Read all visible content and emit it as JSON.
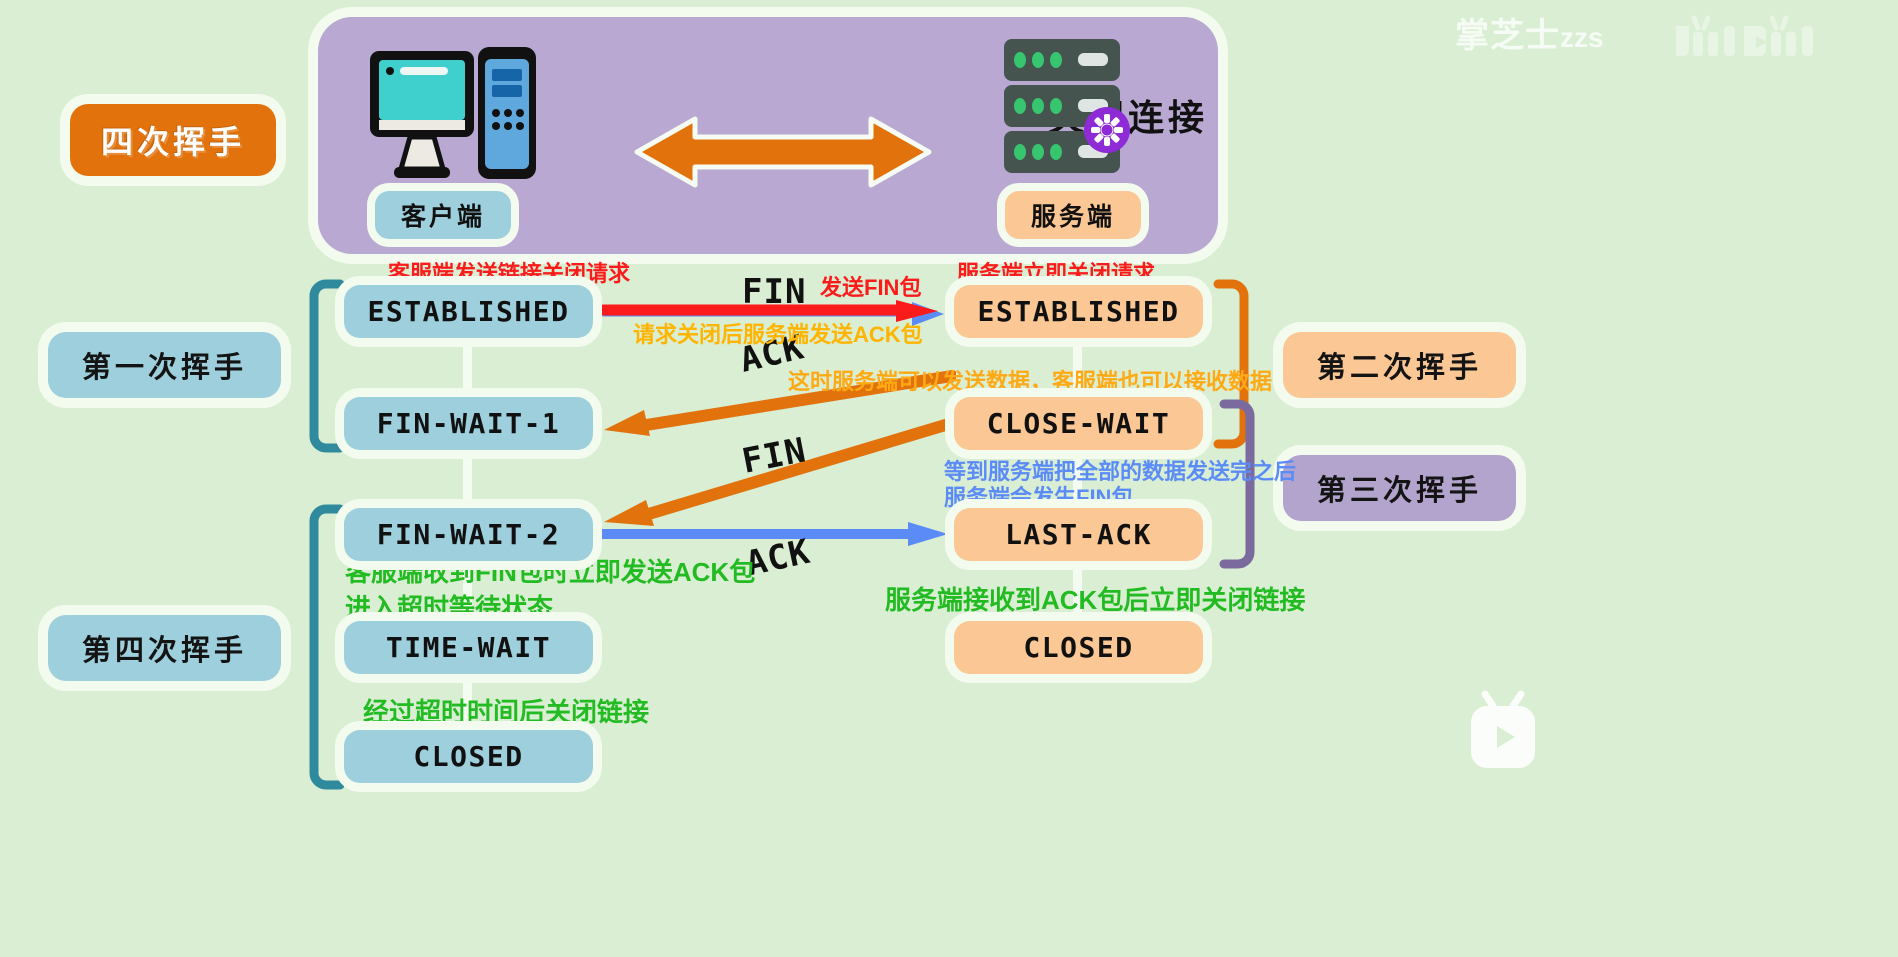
{
  "watermark": {
    "name": "掌芝士",
    "suffix": "zzs",
    "platform": "bilibili"
  },
  "top_panel": {
    "title": "关闭连接",
    "client_label": "客户端",
    "server_label": "服务端",
    "client_icon": "desktop-computer-icon",
    "server_icon": "server-rack-icon",
    "gear_icon": "gear-icon",
    "arrow_icon": "double-headed-arrow-icon"
  },
  "stage_labels": {
    "main": "四次挥手",
    "first": "第一次挥手",
    "second": "第二次挥手",
    "third": "第三次挥手",
    "fourth": "第四次挥手"
  },
  "client_states": [
    {
      "name": "ESTABLISHED"
    },
    {
      "name": "FIN-WAIT-1"
    },
    {
      "name": "FIN-WAIT-2"
    },
    {
      "name": "TIME-WAIT"
    },
    {
      "name": "CLOSED"
    }
  ],
  "server_states": [
    {
      "name": "ESTABLISHED"
    },
    {
      "name": "CLOSE-WAIT"
    },
    {
      "name": "LAST-ACK"
    },
    {
      "name": "CLOSED"
    }
  ],
  "packets": {
    "fin1": "FIN",
    "ack1": "ACK",
    "fin2": "FIN",
    "ack2": "ACK"
  },
  "annotations": {
    "client_close_request": "客服端发送链接关闭请求",
    "send_fin_packet": "发送FIN包",
    "server_close_request": "服务端立即关闭请求",
    "server_sends_ack": "请求关闭后服务端发送ACK包",
    "server_can_send_data": "这时服务端可以发送数据，客服端也可以接收数据",
    "server_finish_line1": "等到服务端把全部的数据发送完之后",
    "server_finish_line2": "服务端会发生FIN包",
    "client_ack_line1": "客服端收到FIN包时立即发送ACK包",
    "client_ack_line2": "进入超时等待状态",
    "client_timeout_close": "经过超时时间后关闭链接",
    "server_close_on_ack": "服务端接收到ACK包后立即关闭链接"
  },
  "bottom_caption": "",
  "colors": {
    "background": "#d9eed2",
    "panel_purple": "#b8a8d2",
    "client_blue": "#9ecfdc",
    "server_peach": "#fbc794",
    "accent_orange": "#e2720c",
    "arrow_red": "#fb1b1b",
    "arrow_blue": "#5b8bf7",
    "text_green": "#22bb22",
    "text_yellow": "#ffb400"
  }
}
